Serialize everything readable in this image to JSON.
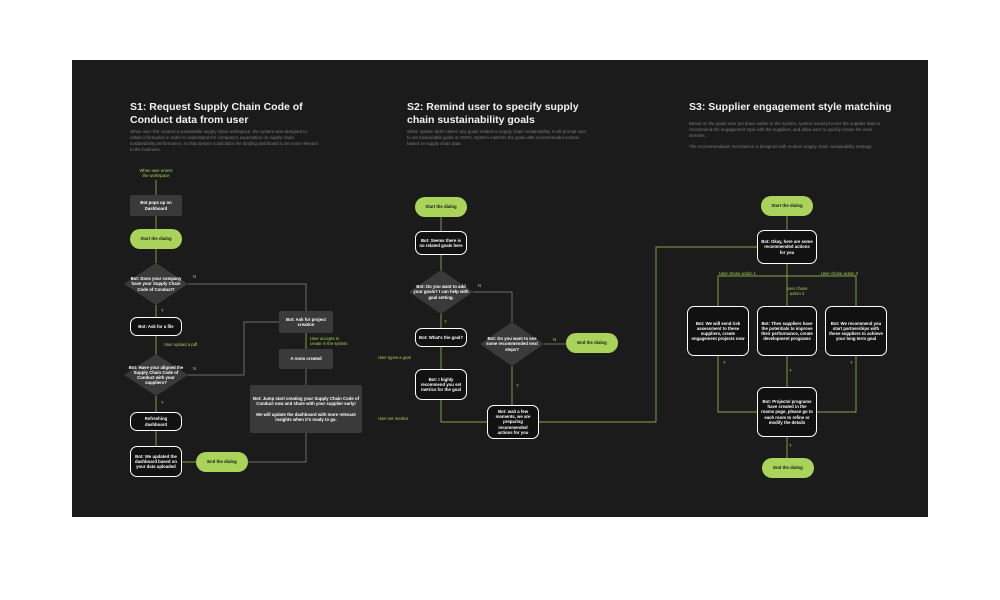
{
  "columns": [
    {
      "title": "S1: Request Supply Chain Code of Conduct data from user",
      "description": [
        "When user first created a sustainable supply chain workspace, the system was designed to obtain information in order to understand the company's expectation on supply chain sustainability performance, so that system could tailor the landing dashboard to be more relevant to the business."
      ]
    },
    {
      "title": "S2: Remind user to specify supply chain sustainability goals",
      "description": [
        "When system didn't detect any goals related to supply chain sustainability, it will prompt user to set measurable goals or OKRs. System matches the goals with recommended actions based on supply chain data."
      ]
    },
    {
      "title": "S3: Supplier engagement style matching",
      "description": [
        "Based on the goals user put down earlier in the system, system would process the supplier data to recommend the engagement style with the suppliers, and allow user to quickly create the work streams.",
        "The recommendation mechanism is designed with modern supply chain sustainability strategy."
      ]
    }
  ],
  "nodes": {
    "s1_bot_popup": "Bot pops up on Dashboard",
    "s1_start": "Start the dialog",
    "s1_q_code": "Bot: Does your company have your Supply Chain Code of Conduct?",
    "s1_ask_file": "Bot: Ask for a file",
    "s1_q_aligned": "Bot: Have your aligned the Supply Chain Code of Conduct with your suppliers?",
    "s1_refreshing": "Refreshing dashboard",
    "s1_updated": "Bot: We updated the dashboard based on your data uploaded",
    "s1_end": "End the dialog",
    "s1_ask_project": "Bot: Ask for project creation",
    "s1_room_created": "A room created",
    "s1_jumpstart": "Bot: Jump start creating your Supply Chain Code of Conduct now and share with your supplier early!\n\nWe will update the dashboard with more relevant insights when it's ready to go.",
    "s2_start": "Start the dialog",
    "s2_no_goals": "Bot: Seems there is no related goals here",
    "s2_q_add_goals": "Bot: Do you want to add your goals? I can help with goal setting.",
    "s2_whats_goal": "Bot: What's the goal?",
    "s2_recommend_metrics": "Bot: I highly recommend you set metrics for the goal",
    "s2_q_see_actions": "Bot: Do you want to see some recommended next steps?",
    "s2_end": "End the dialog",
    "s2_wait": "Bot: wait a few moments, we are preparing recommended actions for you",
    "s3_start": "Start the dialog",
    "s3_okay": "Bot: Okay, here are some recommended actions for you",
    "s3_action1": "Bot: We will send risk assessment to these suppliers, create engagement projects now",
    "s3_action2": "Bot: Thes suppliers have the potentials to improve their performance, create development programs",
    "s3_action3": "Bot: We recommend you start partnerships with these suppliers to achieve your long term goal",
    "s3_projects": "Bot: Projects/ programs have created in the rooms page, please go to each room to refine or modify the details",
    "s3_end": "End the dialog"
  },
  "labels": {
    "s1_enter_workspace": "When user enters\nthe workspace",
    "s1_n1": "N",
    "s1_y1": "Y",
    "s1_upload_pdf": "User upload a pdf",
    "s1_n2": "N",
    "s1_y2": "Y",
    "s1_accepts": "User accepts to\ncreate in the system",
    "s2_n1": "N",
    "s2_y1": "Y",
    "s2_types_goal": "User types a goal",
    "s2_set_metrics": "User set metrics",
    "s2_n2": "N",
    "s2_y2": "Y",
    "s3_chose1": "User chose action 1",
    "s3_chose2": "User chose\naction 2",
    "s3_chose3": "User chose action 3",
    "s3_y1": "Y",
    "s3_y2": "Y",
    "s3_y3": "Y",
    "s3_y4": "Y"
  },
  "colors": {
    "canvas": "#1b1b1b",
    "accent_green": "#a9d35a",
    "connector": "#8a8a8a",
    "dark_node": "#3a3a3a"
  }
}
